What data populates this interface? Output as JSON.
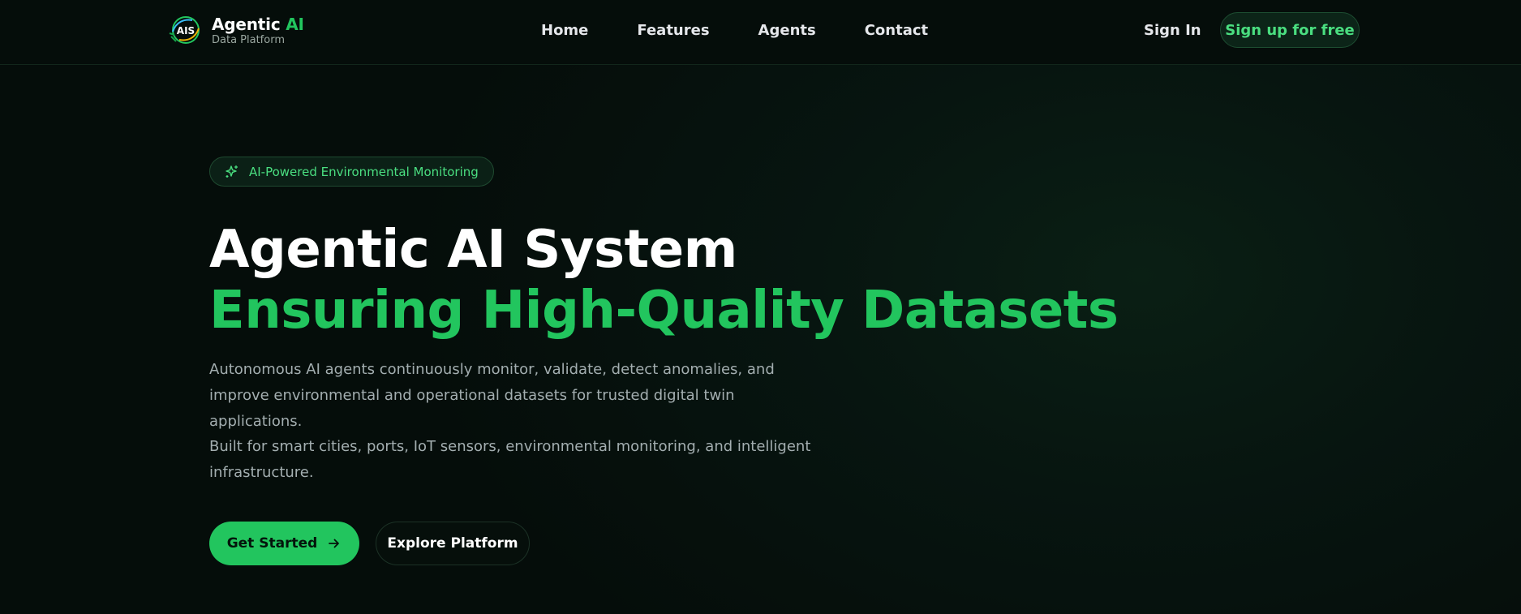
{
  "brand": {
    "logo_text": "AIS",
    "title_white": "Agentic",
    "title_green": "AI",
    "subtitle": "Data Platform",
    "icon": "leaf-globe-logo-icon"
  },
  "nav": {
    "links": [
      "Home",
      "Features",
      "Agents",
      "Contact"
    ],
    "sign_in": "Sign In",
    "sign_up": "Sign up for free"
  },
  "hero": {
    "badge": "AI-Powered Environmental Monitoring",
    "badge_icon": "sparkles-icon",
    "title_line1": "Agentic AI System",
    "title_line2": "Ensuring High-Quality Datasets",
    "description1": "Autonomous AI agents continuously monitor, validate, detect anomalies, and improve environmental and operational datasets for trusted digital twin applications.",
    "description2": "Built for smart cities, ports, IoT sensors, environmental monitoring, and intelligent infrastructure.",
    "primary_button": "Get Started",
    "primary_icon": "arrow-right-icon",
    "secondary_button": "Explore Platform"
  },
  "colors": {
    "accent": "#22c55e",
    "accent_light": "#4ade80",
    "background": "#050d0a",
    "text_muted": "#a3aeb0"
  }
}
